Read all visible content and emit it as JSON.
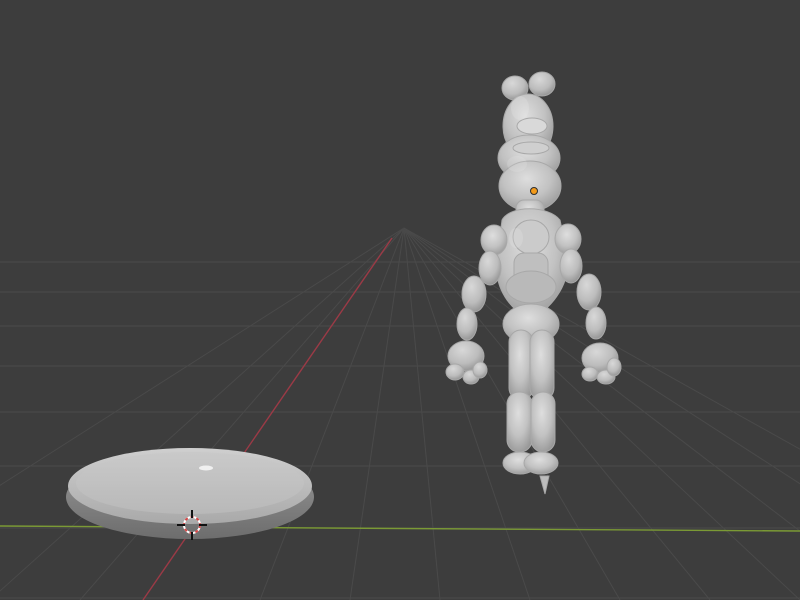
{
  "viewport": {
    "background": "#3d3d3d",
    "grid_color": "#4a4a4a",
    "x_axis_color": "#9b3a46",
    "y_axis_color": "#7b9a35"
  },
  "objects": {
    "figure": {
      "name": "character-sculpt",
      "color": "#c4c4c4",
      "origin_color": "#f29a1a"
    },
    "base": {
      "name": "display-base",
      "color": "#b8b8b8"
    },
    "cursor": {
      "name": "3d-cursor"
    }
  }
}
